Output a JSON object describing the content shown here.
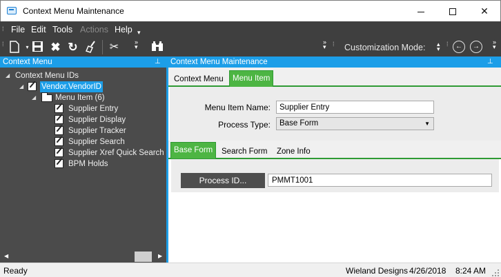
{
  "window": {
    "title": "Context Menu Maintenance"
  },
  "menubar": {
    "items": [
      "File",
      "Edit",
      "Tools",
      "Actions",
      "Help"
    ]
  },
  "toolbar": {
    "customization_label": "Customization Mode:"
  },
  "left_pane": {
    "title": "Context Menu",
    "tree": {
      "root": "Context Menu IDs",
      "node": "Vendor.VendorID",
      "group": "Menu Item (6)",
      "items": [
        "Supplier Entry",
        "Supplier Display",
        "Supplier Tracker",
        "Supplier Search",
        "Supplier Xref Quick Search",
        "BPM Holds"
      ]
    }
  },
  "right_pane": {
    "title": "Context Menu Maintenance",
    "tabs": [
      "Context Menu",
      "Menu Item"
    ],
    "active_tab": "Menu Item",
    "fields": {
      "menu_item_name_label": "Menu Item Name:",
      "menu_item_name_value": "Supplier Entry",
      "process_type_label": "Process Type:",
      "process_type_value": "Base Form"
    },
    "subtabs": [
      "Base Form",
      "Search Form",
      "Zone Info"
    ],
    "active_subtab": "Base Form",
    "process_button": "Process ID...",
    "process_id_value": "PMMT1001"
  },
  "statusbar": {
    "status": "Ready",
    "company": "Wieland Designs",
    "date": "4/26/2018",
    "time": "8:24 AM"
  },
  "colors": {
    "accent": "#1c9ee8",
    "tab_active": "#4db543",
    "dark_panel": "#4b4b4b",
    "menubar": "#3f3f3f"
  }
}
